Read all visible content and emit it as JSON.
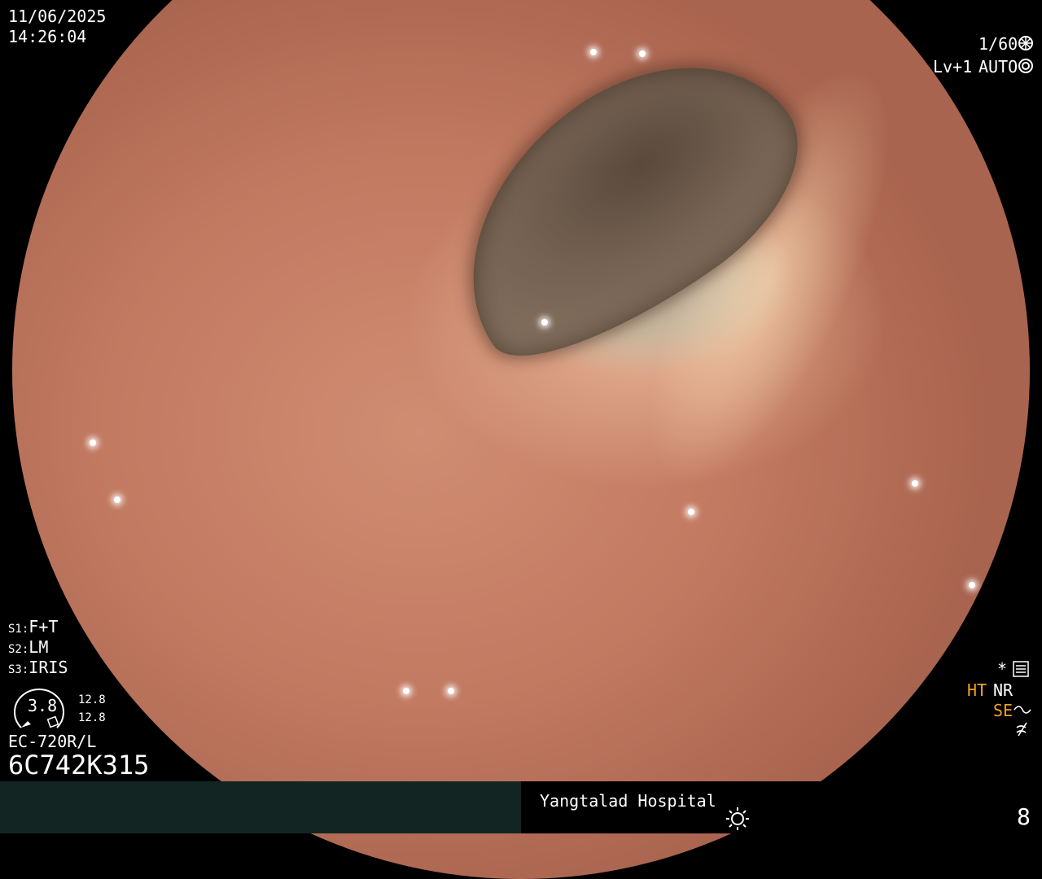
{
  "top_left": {
    "date": "11/06/2025",
    "time": "14:26:04"
  },
  "top_right": {
    "shutter": "1/60",
    "level": "Lv+1",
    "mode": "AUTO"
  },
  "settings": {
    "s1_key": "S1:",
    "s1_val": "F+T",
    "s2_key": "S2:",
    "s2_val": "LM",
    "s3_key": "S3:",
    "s3_val": "IRIS"
  },
  "gauge": {
    "value": "3.8",
    "upper": "12.8",
    "lower": "12.8"
  },
  "scope_info": {
    "model": "EC-720R/L",
    "serial": "6C742K315"
  },
  "right_panel": {
    "ht": "HT",
    "nr": "NR",
    "se": "SE"
  },
  "footer": {
    "hospital": "Yangtalad Hospital",
    "page": "8"
  },
  "colors": {
    "orange": "#f0a020",
    "footer_left_bg": "#132523"
  },
  "icons": [
    "aperture-icon",
    "auto-iris-icon",
    "settings-icon",
    "sun-icon",
    "contrast-icon",
    "enhance-icon"
  ]
}
